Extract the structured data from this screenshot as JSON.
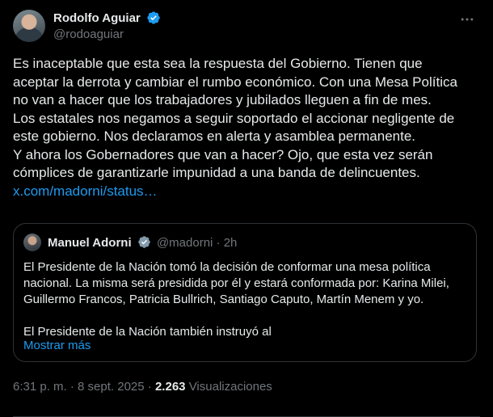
{
  "author": {
    "name": "Rodolfo Aguiar",
    "handle": "@rodoaguiar"
  },
  "tweet": {
    "text": "Es inaceptable que esta sea la respuesta del Gobierno. Tienen que\naceptar la derrota y cambiar el rumbo económico. Con una Mesa Política\nno van a hacer que los trabajadores y jubilados lleguen a fin de mes.\nLos estatales nos negamos a seguir soportado el accionar negligente de\neste gobierno. Nos declaramos en alerta y asamblea permanente.\nY ahora los Gobernadores que van a hacer? Ojo, que esta vez serán\ncómplices de garantizarle impunidad a una banda de delincuentes.",
    "link": "x.com/madorni/status…"
  },
  "quote": {
    "name": "Manuel Adorni",
    "handle": "@madorni",
    "dot": "·",
    "time": "2h",
    "text": "El Presidente de la Nación tomó la decisión de conformar una mesa política\nnacional. La misma será presidida por él y estará conformada por: Karina Milei,\nGuillermo Francos, Patricia Bullrich, Santiago Caputo, Martín Menem y yo.\n\nEl Presidente de la Nación también instruyó al",
    "show_more": "Mostrar más"
  },
  "meta": {
    "time": "6:31 p. m.",
    "sep1": "·",
    "date": "8 sept. 2025",
    "sep2": "·",
    "views_count": "2.263",
    "views_label": "Visualizaciones"
  },
  "colors": {
    "accent": "#1d9bf0",
    "background": "#000000",
    "text": "#e7e9ea",
    "muted": "#71767b",
    "border": "#2f3336"
  },
  "icons": {
    "verified": "verified-badge-icon",
    "more": "more-options-icon"
  }
}
